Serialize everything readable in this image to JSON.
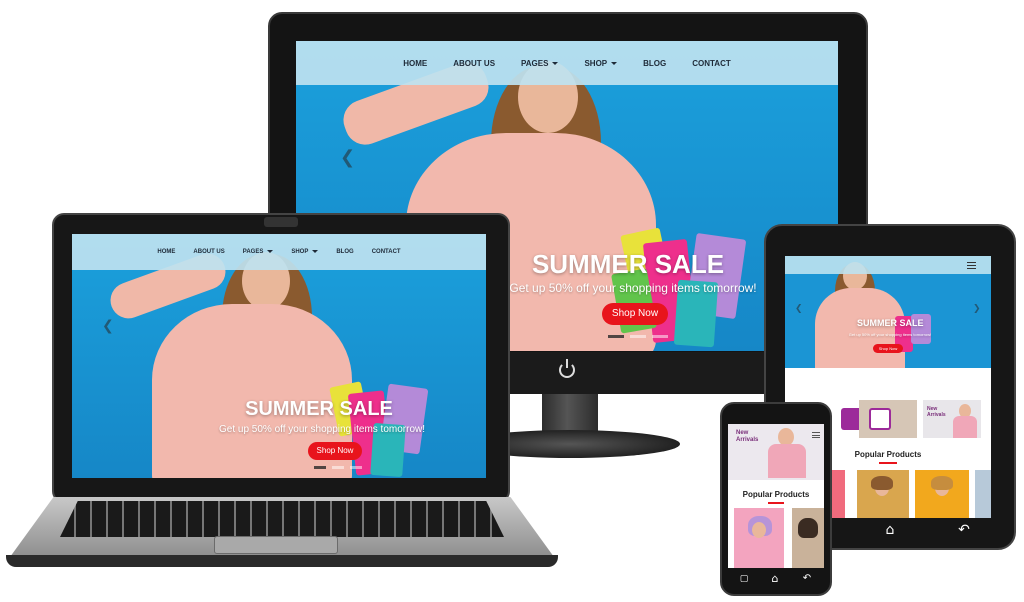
{
  "nav": {
    "items": [
      {
        "label": "HOME",
        "dropdown": false
      },
      {
        "label": "ABOUT US",
        "dropdown": false
      },
      {
        "label": "PAGES",
        "dropdown": true
      },
      {
        "label": "SHOP",
        "dropdown": true
      },
      {
        "label": "BLOG",
        "dropdown": false
      },
      {
        "label": "CONTACT",
        "dropdown": false
      }
    ]
  },
  "hero": {
    "title": "SUMMER SALE",
    "subtitle": "Get up 50% off your shopping items tomorrow!",
    "button": "Shop Now"
  },
  "tablet": {
    "section_title": "Popular Products",
    "banner_text": "New Arrivals"
  },
  "phone": {
    "section_title": "Popular Products",
    "banner_text": "New Arrivals"
  },
  "icons": {
    "prev": "chevron-left-icon",
    "next": "chevron-right-icon",
    "power": "power-icon",
    "home": "home-icon",
    "back": "back-icon",
    "menu": "hamburger-icon"
  },
  "colors": {
    "accent_red": "#e8141c",
    "hero_blue": "#1b95d4",
    "nav_bg": "#bee2f0"
  }
}
